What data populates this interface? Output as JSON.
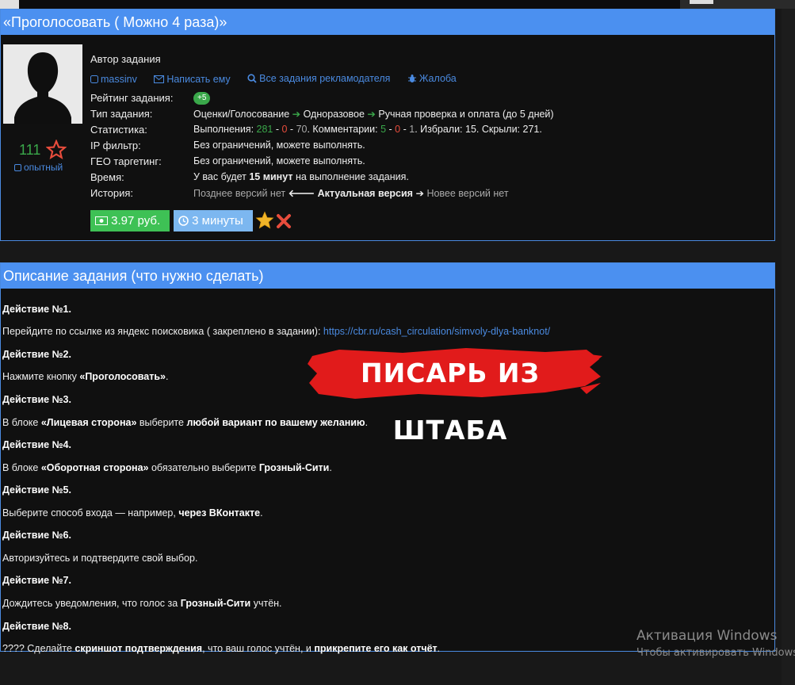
{
  "task": {
    "title": "«Проголосовать ( Можно 4 раза)»",
    "author_label": "Автор задания",
    "author_name": "massinv",
    "write_link": "Написать ему",
    "all_tasks_link": "Все задания рекламодателя",
    "complaint_link": "Жалоба",
    "rating_value": "111",
    "level": "опытный",
    "rating_label": "Рейтинг задания:",
    "rating_badge": "+5",
    "type_label": "Тип задания:",
    "type_parts": [
      "Оценки/Голосование",
      "Одноразовое",
      "Ручная проверка и оплата (до 5 дней)"
    ],
    "stats_label": "Статистика:",
    "stats": {
      "done_prefix": "Выполнения:",
      "done_ok": "281",
      "done_bad": "0",
      "done_pending": "70",
      "comments_prefix": ". Комментарии:",
      "comments_ok": "5",
      "comments_bad": "0",
      "comments_pending": "1",
      "suffix": ". Избрали: 15. Скрыли: 271."
    },
    "ip_label": "IP фильтр:",
    "ip_value": "Без ограничений, можете выполнять.",
    "geo_label": "ГЕО таргетинг:",
    "geo_value": "Без ограничений, можете выполнять.",
    "time_label": "Время:",
    "time_prefix": "У вас будет",
    "time_bold": "15 минут",
    "time_suffix": "на выполнение задания.",
    "history_label": "История:",
    "history_older": "Позднее версий нет",
    "history_current": "Актуальная версия",
    "history_newer": "Новее версий нет",
    "price": "3.97 руб.",
    "duration": "3 минуты"
  },
  "description": {
    "title": "Описание задания (что нужно сделать)",
    "steps": [
      {
        "title": "Действие №1.",
        "text": "Перейдите по ссылке из яндекс поисковика ( закреплено в  задании):",
        "link": "https://cbr.ru/cash_circulation/simvoly-dlya-banknot/"
      },
      {
        "title": "Действие №2.",
        "pre": "Нажмите кнопку",
        "b1": "«Проголосовать»",
        "post": "."
      },
      {
        "title": "Действие №3.",
        "pre": "В блоке",
        "b1": "«Лицевая сторона»",
        "mid": "выберите",
        "b2": "любой вариант по вашему желанию",
        "post": "."
      },
      {
        "title": "Действие №4.",
        "pre": "В блоке",
        "b1": "«Оборотная сторона»",
        "mid": "обязательно выберите",
        "b2": "Грозный-Сити",
        "post": "."
      },
      {
        "title": "Действие №5.",
        "pre": "Выберите способ входа — например,",
        "b1": "через ВКонтакте",
        "post": "."
      },
      {
        "title": "Действие №6.",
        "text": "Авторизуйтесь и подтвердите свой выбор."
      },
      {
        "title": "Действие №7.",
        "pre": "Дождитесь уведомления, что голос за",
        "b1": "Грозный-Сити",
        "post": "учтён."
      },
      {
        "title": "Действие №8.",
        "pre": "???? Сделайте",
        "b1": "скриншот подтверждения",
        "mid": ", что ваш голос учтён, и",
        "b2": "прикрепите его как отчёт",
        "post": "."
      }
    ]
  },
  "watermark": "ПИСАРЬ ИЗ ШТАБА",
  "os_notice": {
    "line1": "Активация Windows",
    "line2": "Чтобы активировать Windows"
  },
  "colors": {
    "header_blue": "#4b90f0",
    "link_blue": "#4a8ae0",
    "green": "#3aa84a",
    "red": "#e74c3c"
  }
}
